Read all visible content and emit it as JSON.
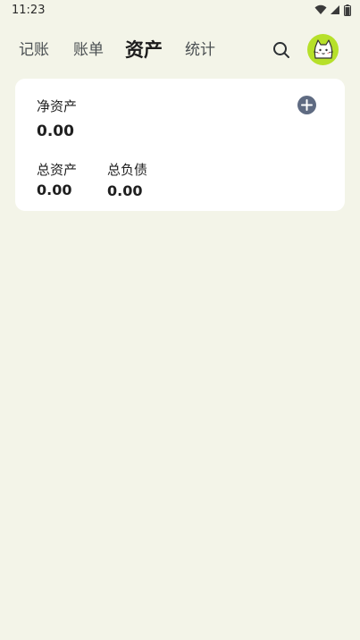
{
  "status_bar": {
    "time": "11:23",
    "icons": [
      "wifi-icon",
      "signal-icon",
      "battery-icon"
    ]
  },
  "nav": {
    "tabs": [
      {
        "label": "记账",
        "active": false
      },
      {
        "label": "账单",
        "active": false
      },
      {
        "label": "资产",
        "active": true
      },
      {
        "label": "统计",
        "active": false
      }
    ],
    "search_icon": "search-icon",
    "avatar_icon": "cat-avatar-icon"
  },
  "asset_card": {
    "net_assets_label": "净资产",
    "net_assets_value": "0.00",
    "add_icon": "plus-circle-icon",
    "total_assets_label": "总资产",
    "total_assets_value": "0.00",
    "total_liabilities_label": "总负债",
    "total_liabilities_value": "0.00"
  },
  "colors": {
    "background": "#f3f4e8",
    "card": "#ffffff",
    "avatar_bg": "#b6e02a",
    "add_button": "#5f6b82"
  }
}
